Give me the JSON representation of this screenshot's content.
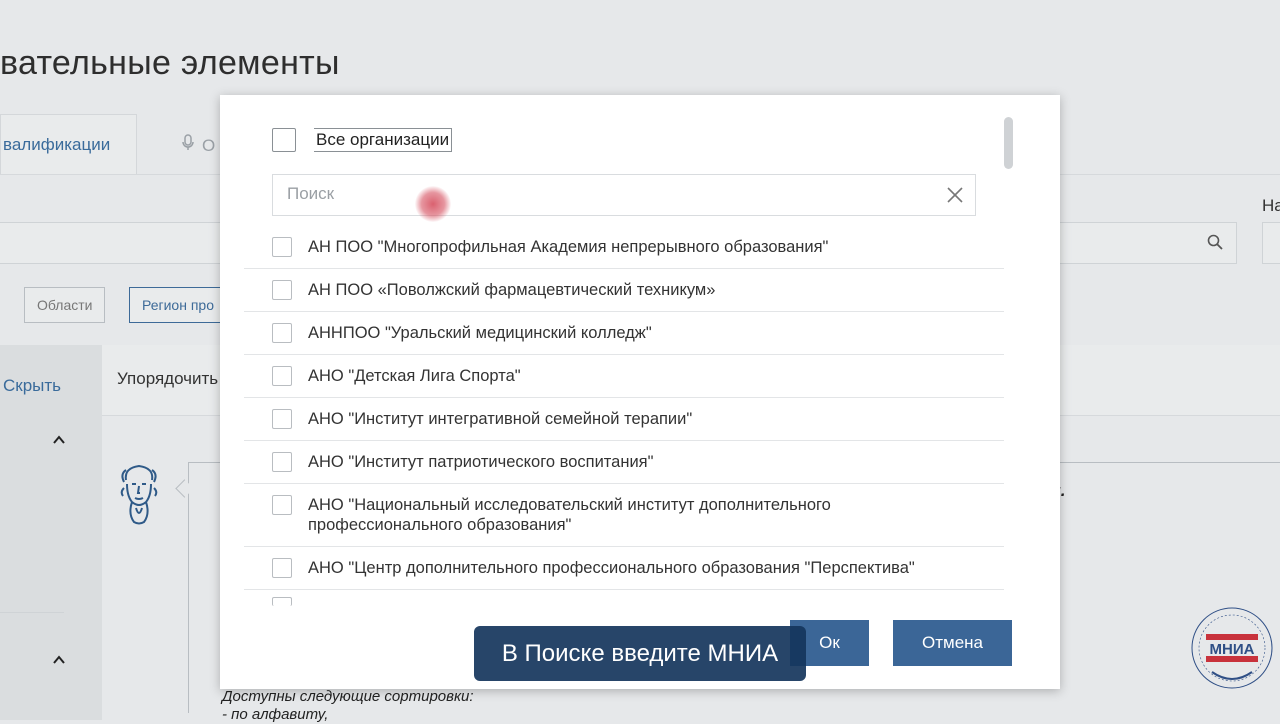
{
  "background": {
    "page_title": "вательные элементы",
    "tab_active": "валификации",
    "tab_secondary": "О",
    "label_right": "На",
    "filter_regions": "Области",
    "filter_region_pro": "Регион про",
    "sidebar_hide": "Скрыть",
    "sort_label": "Упорядочить",
    "bubble_text_fragment": "ий.",
    "sort_note_line1": "Доступны следующие сортировки:",
    "sort_note_line2": "- по алфавиту,"
  },
  "modal": {
    "all_orgs_label": "Все организации",
    "search": {
      "placeholder": "Поиск",
      "value": ""
    },
    "organizations": [
      "АН ПОО \"Многопрофильная Академия непрерывного образования\"",
      "АН ПОО «Поволжский фармацевтический техникум»",
      "АННПОО \"Уральский медицинский колледж\"",
      "АНО \"Детская Лига Спорта\"",
      "АНО \"Институт интегративной семейной терапии\"",
      "АНО \"Институт патриотического воспитания\"",
      "АНО \"Национальный исследовательский институт дополнительного профессионального образования\"",
      "АНО \"Центр дополнительного профессионального образования \"Перспектива\""
    ],
    "ok_label": "Ок",
    "cancel_label": "Отмена"
  },
  "caption": "В Поиске введите МНИА",
  "colors": {
    "accent": "#3b6697",
    "caption_bg": "#15355c",
    "link": "#3a6b9b",
    "cursor": "#d65060"
  },
  "icons": {
    "search": "search-icon",
    "clear": "close-icon",
    "mic": "microphone-icon",
    "chevron": "chevron-up-icon",
    "avatar": "philosopher-avatar-icon",
    "logo": "mnia-logo"
  }
}
